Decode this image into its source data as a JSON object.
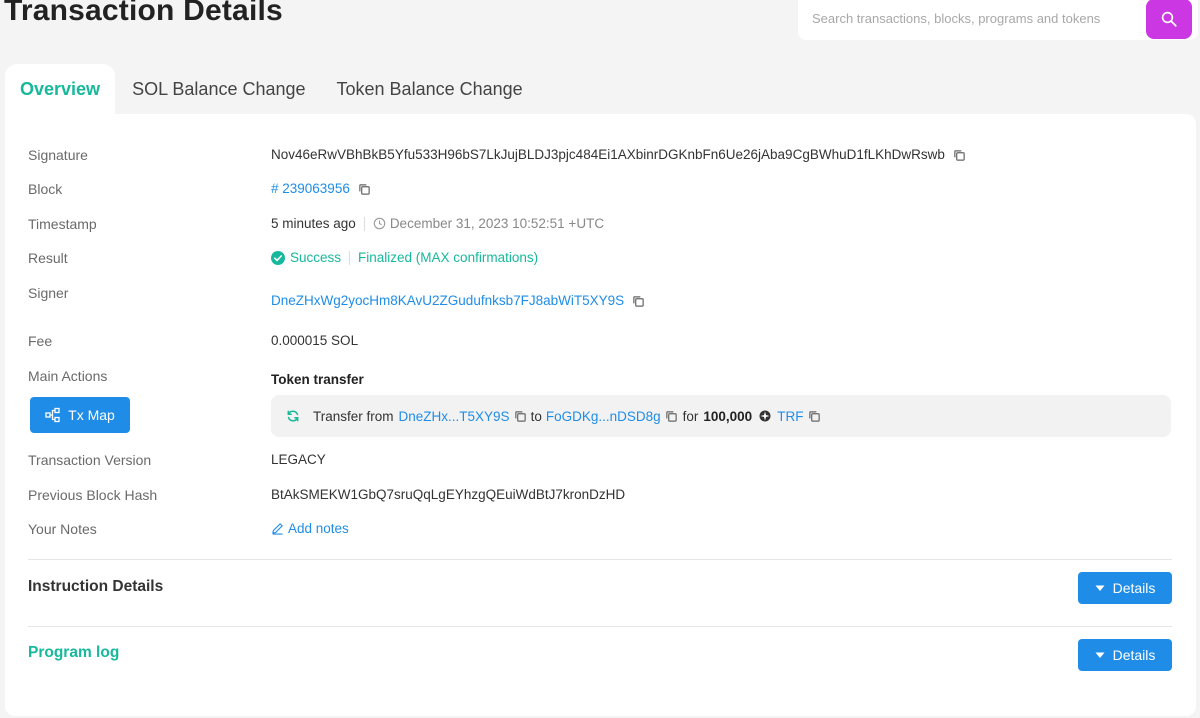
{
  "header": {
    "title": "Transaction Details",
    "search_placeholder": "Search transactions, blocks, programs and tokens",
    "search_icon": "search-icon"
  },
  "tabs": [
    {
      "label": "Overview",
      "active": true
    },
    {
      "label": "SOL Balance Change",
      "active": false
    },
    {
      "label": "Token Balance Change",
      "active": false
    }
  ],
  "overview": {
    "signature": {
      "label": "Signature",
      "value": "Nov46eRwVBhBkB5Yfu533H96bS7LkJujBLDJ3pjc484Ei1AXbinrDGKnbFn6Ue26jAba9CgBWhuD1fLKhDwRswb"
    },
    "block": {
      "label": "Block",
      "value": "# 239063956"
    },
    "timestamp": {
      "label": "Timestamp",
      "relative": "5 minutes ago",
      "absolute": "December 31, 2023 10:52:51 +UTC"
    },
    "result": {
      "label": "Result",
      "status": "Success",
      "finality": "Finalized (MAX confirmations)"
    },
    "signer": {
      "label": "Signer",
      "value": "DneZHxWg2yocHm8KAvU2ZGudufnksb7FJ8abWiT5XY9S"
    },
    "fee": {
      "label": "Fee",
      "value": "0.000015 SOL"
    },
    "main_actions": {
      "label": "Main Actions",
      "tx_map_label": "Tx Map",
      "action_title": "Token transfer",
      "transfer": {
        "prefix": "Transfer from",
        "from": "DneZHx...T5XY9S",
        "to_word": "to",
        "to": "FoGDKg...nDSD8g",
        "for_word": "for",
        "amount": "100,000",
        "token": "TRF"
      }
    },
    "version": {
      "label": "Transaction Version",
      "value": "LEGACY"
    },
    "prev_hash": {
      "label": "Previous Block Hash",
      "value": "BtAkSMEKW1GbQ7sruQqLgEYhzgQEuiWdBtJ7kronDzHD"
    },
    "notes": {
      "label": "Your Notes",
      "action": "Add notes"
    }
  },
  "sections": {
    "instruction_details": {
      "title": "Instruction Details",
      "button": "Details"
    },
    "program_log": {
      "title": "Program log",
      "button": "Details"
    }
  },
  "colors": {
    "accent_green": "#17b89b",
    "link_blue": "#1f8de8",
    "search_purple": "#cc37e4"
  }
}
